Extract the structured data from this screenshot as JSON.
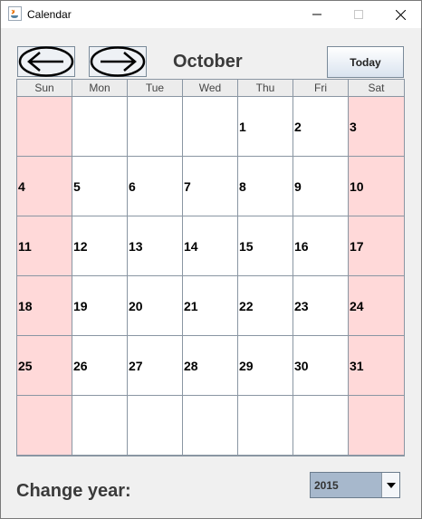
{
  "window": {
    "title": "Calendar"
  },
  "nav": {
    "month": "October",
    "today_label": "Today"
  },
  "weekdays": [
    "Sun",
    "Mon",
    "Tue",
    "Wed",
    "Thu",
    "Fri",
    "Sat"
  ],
  "weeks": [
    [
      "",
      "",
      "",
      "",
      "1",
      "2",
      "3"
    ],
    [
      "4",
      "5",
      "6",
      "7",
      "8",
      "9",
      "10"
    ],
    [
      "11",
      "12",
      "13",
      "14",
      "15",
      "16",
      "17"
    ],
    [
      "18",
      "19",
      "20",
      "21",
      "22",
      "23",
      "24"
    ],
    [
      "25",
      "26",
      "27",
      "28",
      "29",
      "30",
      "31"
    ],
    [
      "",
      "",
      "",
      "",
      "",
      "",
      ""
    ]
  ],
  "footer": {
    "change_year_label": "Change year:",
    "year_value": "2015"
  },
  "colors": {
    "weekend": "#ffd9d9",
    "year_select": "#a7b8cc"
  }
}
